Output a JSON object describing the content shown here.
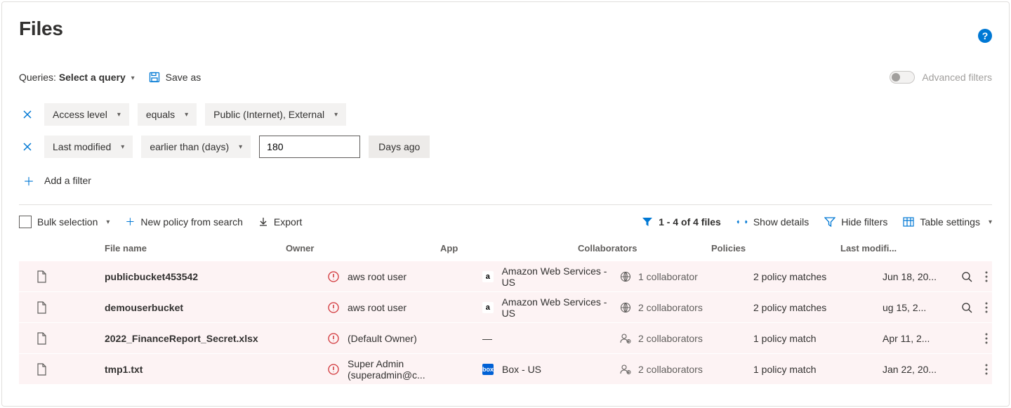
{
  "header": {
    "title": "Files"
  },
  "queryBar": {
    "queriesLabel": "Queries:",
    "selectQuery": "Select a query",
    "saveAs": "Save as",
    "advancedFilters": "Advanced filters"
  },
  "filters": [
    {
      "field": "Access level",
      "operator": "equals",
      "value": "Public (Internet), External"
    },
    {
      "field": "Last modified",
      "operator": "earlier than (days)",
      "input": "180",
      "suffix": "Days ago"
    }
  ],
  "addFilter": "Add a filter",
  "toolbar": {
    "bulkSelection": "Bulk selection",
    "newPolicy": "New policy from search",
    "export": "Export",
    "rangeInfo": "1 - 4 of 4 files",
    "showDetails": "Show details",
    "hideFilters": "Hide filters",
    "tableSettings": "Table settings"
  },
  "columns": {
    "name": "File name",
    "owner": "Owner",
    "app": "App",
    "collaborators": "Collaborators",
    "policies": "Policies",
    "modified": "Last modifi..."
  },
  "rows": [
    {
      "name": "publicbucket453542",
      "owner": "aws root user",
      "app": "Amazon Web Services - US",
      "appLogo": "aws",
      "collabIcon": "globe",
      "collaborators": "1 collaborator",
      "policies": "2 policy matches",
      "modified": "Jun 18, 20...",
      "searchable": true
    },
    {
      "name": "demouserbucket",
      "owner": "aws root user",
      "app": "Amazon Web Services - US",
      "appLogo": "aws",
      "collabIcon": "globe",
      "collaborators": "2 collaborators",
      "policies": "2 policy matches",
      "modified": "ug 15, 2...",
      "searchable": true
    },
    {
      "name": "2022_FinanceReport_Secret.xlsx",
      "owner": "(Default Owner)",
      "app": "—",
      "appLogo": "none",
      "collabIcon": "person",
      "collaborators": "2 collaborators",
      "policies": "1 policy match",
      "modified": "Apr 11, 2...",
      "searchable": false
    },
    {
      "name": "tmp1.txt",
      "owner": "Super Admin (superadmin@c...",
      "app": "Box - US",
      "appLogo": "box",
      "collabIcon": "person",
      "collaborators": "2 collaborators",
      "policies": "1 policy match",
      "modified": "Jan 22, 20...",
      "searchable": false
    }
  ]
}
